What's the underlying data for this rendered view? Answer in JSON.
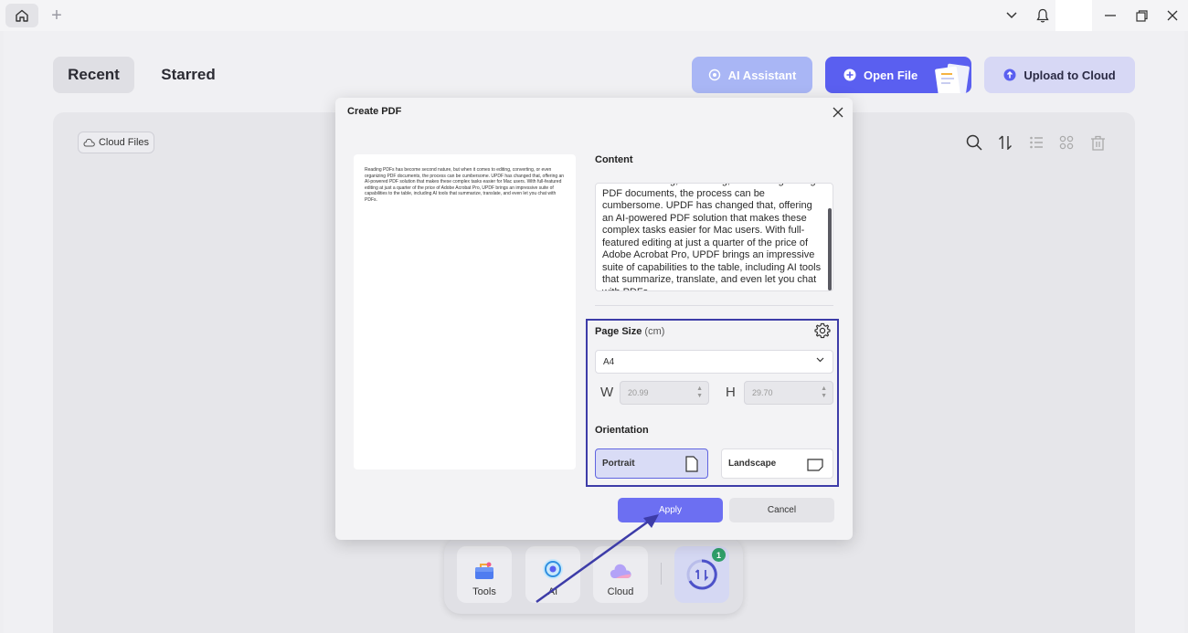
{
  "titlebar": {
    "icons": [
      "home-icon",
      "plus-icon",
      "chevron-down-icon",
      "bell-icon",
      "minimize-icon",
      "restore-icon",
      "close-icon"
    ]
  },
  "tabs": {
    "recent": "Recent",
    "starred": "Starred"
  },
  "toolbar": {
    "ai_assistant": "AI Assistant",
    "open_file": "Open File",
    "upload_cloud": "Upload to Cloud",
    "cloud_files": "Cloud Files"
  },
  "dock": {
    "tools": "Tools",
    "ai": "AI",
    "cloud": "Cloud",
    "badge_count": "1"
  },
  "dialog": {
    "title": "Create PDF",
    "preview_text": "Reading PDFs has become second nature, but when it comes to editing, converting, or even organizing PDF documents, the process can be cumbersome. UPDF has changed that, offering an AI-powered PDF solution that makes these complex tasks easier for Mac users. With full-featured editing at just a quarter of the price of Adobe Acrobat Pro, UPDF brings an impressive suite of capabilities to the table, including AI tools that summarize, translate, and even let you chat with PDFs.",
    "content_label": "Content",
    "content_text": "comes to editing, converting, or even organizing PDF documents, the process can be cumbersome. UPDF has changed that, offering an AI-powered PDF solution that makes these complex tasks easier for Mac users. With full-featured editing at just a quarter of the price of Adobe Acrobat Pro, UPDF brings an impressive suite of capabilities to the table, including AI tools that summarize, translate, and even let you chat with PDFs.",
    "page_size_label": "Page Size",
    "page_size_unit": "(cm)",
    "page_size_value": "A4",
    "width_label": "W",
    "width_value": "20.99",
    "height_label": "H",
    "height_value": "29.70",
    "orientation_label": "Orientation",
    "portrait": "Portrait",
    "landscape": "Landscape",
    "selected_orientation": "Portrait",
    "apply": "Apply",
    "cancel": "Cancel"
  },
  "colors": {
    "accent": "#5a5ff0",
    "apply": "#6c6ff2",
    "highlight_border": "#3d3ca8",
    "badge": "#2f9f6a"
  }
}
